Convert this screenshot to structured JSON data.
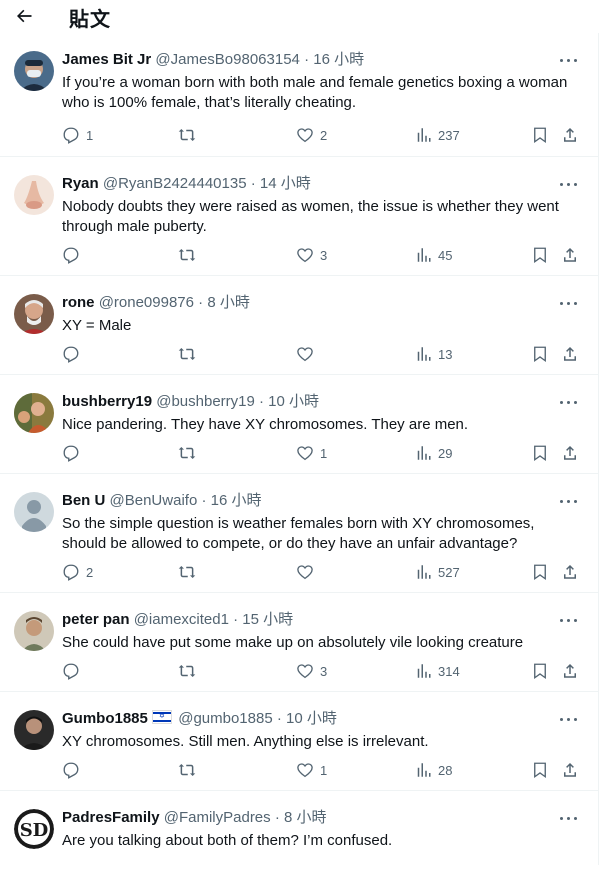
{
  "header": {
    "title": "貼文"
  },
  "replies": [
    {
      "name": "James Bit Jr",
      "handle": "@JamesBo98063154",
      "time": "· 16 小時",
      "text": "If you’re a woman born with both male and female genetics boxing a woman who is 100% female,  that’s literally cheating.",
      "replies": "1",
      "retweets": "",
      "likes": "2",
      "views": "237"
    },
    {
      "name": "Ryan",
      "handle": "@RyanB2424440135",
      "time": "· 14 小時",
      "text": "Nobody doubts they were raised as women, the issue is whether they went through male puberty.",
      "replies": "",
      "retweets": "",
      "likes": "3",
      "views": "45"
    },
    {
      "name": "rone",
      "handle": "@rone099876",
      "time": "· 8 小時",
      "text": "XY = Male",
      "replies": "",
      "retweets": "",
      "likes": "",
      "views": "13"
    },
    {
      "name": "bushberry19",
      "handle": "@bushberry19",
      "time": "· 10 小時",
      "text": "Nice pandering. They have XY chromosomes. They are men.",
      "replies": "",
      "retweets": "",
      "likes": "1",
      "views": "29"
    },
    {
      "name": "Ben U",
      "handle": "@BenUwaifo",
      "time": "· 16 小時",
      "text": "So the simple question is weather females born with XY chromosomes, should be allowed to compete, or do they have an unfair advantage?",
      "replies": "2",
      "retweets": "",
      "likes": "",
      "views": "527"
    },
    {
      "name": "peter pan",
      "handle": "@iamexcited1",
      "time": "· 15 小時",
      "text": "She could have put some make up on absolutely vile looking creature",
      "replies": "",
      "retweets": "",
      "likes": "3",
      "views": "314"
    },
    {
      "name": "Gumbo1885",
      "flag": "israel-flag",
      "handle": "@gumbo1885",
      "time": "· 10 小時",
      "text": "XY chromosomes. Still men. Anything else is irrelevant.",
      "replies": "",
      "retweets": "",
      "likes": "1",
      "views": "28"
    },
    {
      "name": "PadresFamily",
      "handle": "@FamilyPadres",
      "time": "· 8 小時",
      "text": "Are you talking about both of them? I’m confused.",
      "replies": "",
      "retweets": "",
      "likes": "",
      "views": ""
    }
  ],
  "colors": {
    "text": "#0f1419",
    "muted": "#536471",
    "divider": "#eff3f4"
  }
}
